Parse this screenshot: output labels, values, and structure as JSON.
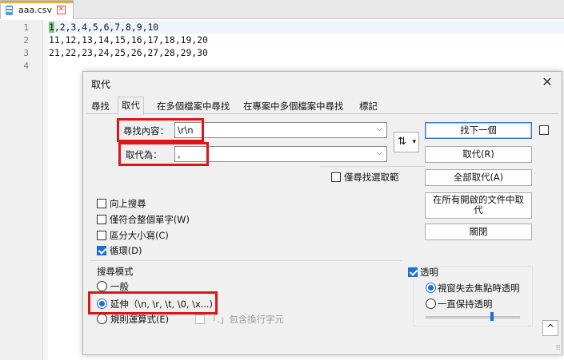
{
  "editor": {
    "tab_label": "aaa.csv",
    "tab_close_glyph": "✕",
    "line_numbers": [
      "1",
      "2",
      "3",
      "4"
    ],
    "first_char": "1",
    "line1_rest": ",2,3,4,5,6,7,8,9,10",
    "line2": "11,12,13,14,15,16,17,18,19,20",
    "line3": "21,22,23,24,25,26,27,28,29,30",
    "line4": ""
  },
  "dialog": {
    "title": "取代",
    "close_glyph": "✕",
    "tabs": [
      "尋找",
      "取代",
      "在多個檔案中尋找",
      "在專案中多個檔案中尋找",
      "標記"
    ],
    "find_label": "尋找內容：",
    "find_value": "\\r\\n",
    "replace_label": "取代為：",
    "replace_value": ",",
    "combo_arrow": "⌵",
    "swap_glyph": "⇅",
    "swap_dropdown": "▾",
    "in_selection_label": "僅尋找選取範",
    "buttons": {
      "find_next": "找下一個",
      "replace": "取代(R)",
      "replace_all": "全部取代(A)",
      "replace_all_open_line1": "在所有開啟的文件中取",
      "replace_all_open_line2": "代",
      "close": "關閉"
    },
    "options": {
      "backward": "向上搜尋",
      "whole_word": "僅符合整個單字(W)",
      "match_case": "區分大小寫(C)",
      "wrap": "循環(D)"
    },
    "search_mode": {
      "title": "搜尋模式",
      "normal": "一般",
      "extended": "延伸（\\n, \\r, \\t, \\0, \\x...)",
      "regex": "規則運算式(E)",
      "dot_newline": "「.」包含換行字元"
    },
    "transparency": {
      "title": "透明",
      "on_lose_focus": "視窗失去焦點時透明",
      "always": "一直保持透明",
      "level": 0.7
    },
    "collapse_glyph": "^",
    "grip_glyph": "⠿"
  },
  "colors": {
    "highlight_box": "#e01414",
    "accent": "#1f6fd1",
    "selected_text": "#7fd07f"
  }
}
